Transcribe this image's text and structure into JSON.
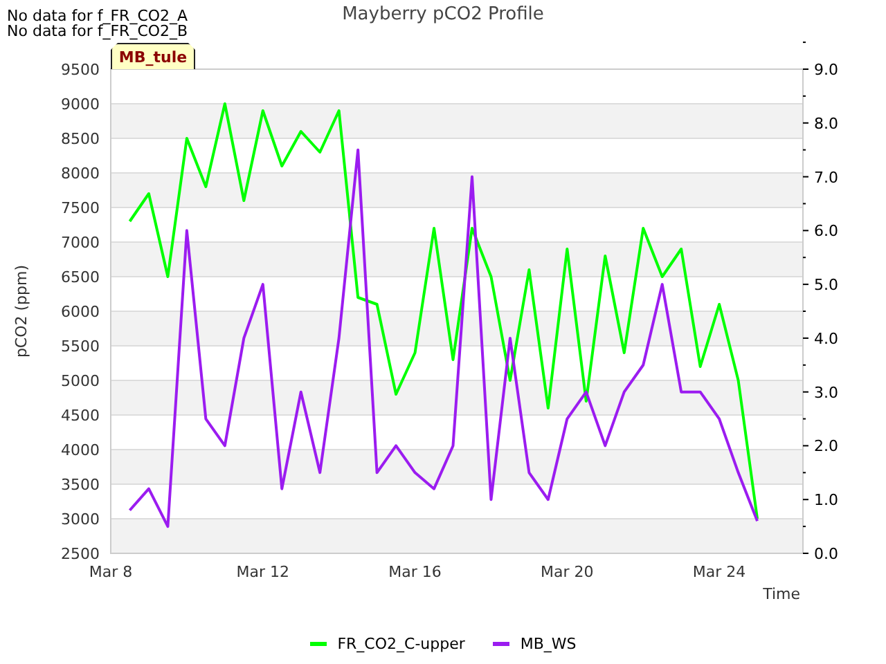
{
  "notes": [
    "No data for f_FR_CO2_A",
    "No data for f_FR_CO2_B"
  ],
  "site_tag": "MB_tule",
  "chart_data": {
    "type": "line",
    "title": "Mayberry pCO2 Profile",
    "xlabel": "Time",
    "ylabel": "pCO2 (ppm)",
    "categories": [
      "Mar 8",
      null,
      null,
      null,
      null,
      null,
      null,
      null,
      "Mar 12",
      null,
      null,
      null,
      null,
      null,
      null,
      null,
      "Mar 16",
      null,
      null,
      null,
      null,
      null,
      null,
      null,
      "Mar 20",
      null,
      null,
      null,
      null,
      null,
      null,
      null,
      "Mar 24",
      null,
      null
    ],
    "grid": true,
    "bands": [
      {
        "axis": "y",
        "from": 2500,
        "to": 3000
      },
      {
        "axis": "y",
        "from": 3500,
        "to": 4000
      },
      {
        "axis": "y",
        "from": 4500,
        "to": 5000
      },
      {
        "axis": "y",
        "from": 5500,
        "to": 6000
      },
      {
        "axis": "y",
        "from": 6500,
        "to": 7000
      },
      {
        "axis": "y",
        "from": 7500,
        "to": 8000
      },
      {
        "axis": "y",
        "from": 8500,
        "to": 9000
      }
    ],
    "ylim": [
      2500,
      9500
    ],
    "yticks": [
      2500,
      3000,
      3500,
      4000,
      4500,
      5000,
      5500,
      6000,
      6500,
      7000,
      7500,
      8000,
      8500,
      9000,
      9500
    ],
    "y2lim": [
      0,
      9
    ],
    "y2ticks": [
      {
        "value": 0,
        "label": "0.0"
      },
      {
        "value": 1,
        "label": "1.0"
      },
      {
        "value": 2,
        "label": "2.0"
      },
      {
        "value": 3,
        "label": "3.0"
      },
      {
        "value": 4,
        "label": "4.0"
      },
      {
        "value": 5,
        "label": "5.0"
      },
      {
        "value": 6,
        "label": "6.0"
      },
      {
        "value": 7,
        "label": "7.0"
      },
      {
        "value": 8,
        "label": "8.0"
      },
      {
        "value": 9,
        "label": "9.0"
      }
    ],
    "series": [
      {
        "name": "FR_CO2_C-upper",
        "color": "#00ff00",
        "values": [
          null,
          7300,
          7700,
          6500,
          8500,
          7800,
          9000,
          7600,
          8900,
          8100,
          8600,
          8300,
          8900,
          6200,
          6100,
          4800,
          5400,
          7200,
          5300,
          7200,
          6500,
          5000,
          6600,
          4600,
          6900,
          4700,
          6800,
          5400,
          7200,
          6500,
          6900,
          5200,
          6100,
          5000,
          3000
        ]
      },
      {
        "name": "MB_WS",
        "color": "#9b1cf0",
        "axis": "y2",
        "values": [
          null,
          0.8,
          1.2,
          0.5,
          6.0,
          2.5,
          2.0,
          4.0,
          5.0,
          1.2,
          3.0,
          1.5,
          4.0,
          7.5,
          1.5,
          2.0,
          1.5,
          1.2,
          2.0,
          7.0,
          1.0,
          4.0,
          1.5,
          1.0,
          2.5,
          3.0,
          2.0,
          3.0,
          3.5,
          5.0,
          3.0,
          3.0,
          2.5,
          1.5,
          0.6
        ]
      }
    ]
  }
}
